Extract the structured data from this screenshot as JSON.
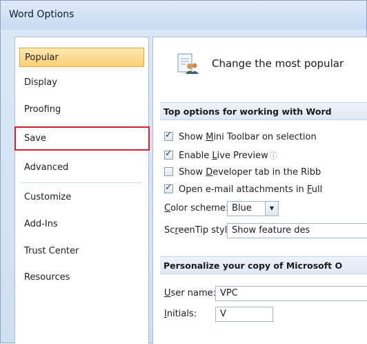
{
  "window": {
    "title": "Word Options"
  },
  "sidebar": {
    "items": [
      {
        "label": "Popular"
      },
      {
        "label": "Display"
      },
      {
        "label": "Proofing"
      },
      {
        "label": "Save"
      },
      {
        "label": "Advanced"
      },
      {
        "label": "Customize"
      },
      {
        "label": "Add-Ins"
      },
      {
        "label": "Trust Center"
      },
      {
        "label": "Resources"
      }
    ]
  },
  "main": {
    "header": "Change the most popular",
    "top_options": {
      "title": "Top options for working with Word",
      "options": [
        {
          "pre": "Show ",
          "ul": "M",
          "post": "ini Toolbar on selection",
          "checked": true
        },
        {
          "pre": "Enable ",
          "ul": "L",
          "post": "ive Preview",
          "checked": true
        },
        {
          "pre": "Show ",
          "ul": "D",
          "post": "eveloper tab in the Ribb",
          "checked": false
        },
        {
          "pre": "Open e-mail attachments in ",
          "ul": "F",
          "post": "ull",
          "checked": true
        }
      ],
      "color_scheme": {
        "label_ul": "C",
        "label_rest": "olor scheme:",
        "value": "Blue"
      },
      "screentip": {
        "label_pre": "Sc",
        "label_ul": "r",
        "label_rest": "eenTip style:",
        "value": "Show feature des"
      }
    },
    "personalize": {
      "title": "Personalize your copy of Microsoft O",
      "user_name": {
        "label_ul": "U",
        "label_rest": "ser name:",
        "value": "VPC"
      },
      "initials": {
        "label_ul": "I",
        "label_rest": "nitials:",
        "value": "V"
      }
    }
  },
  "colors": {
    "selected_bg": "#fbcf73",
    "highlight_border": "#d7212e",
    "window_bg": "#dbe8f7"
  }
}
